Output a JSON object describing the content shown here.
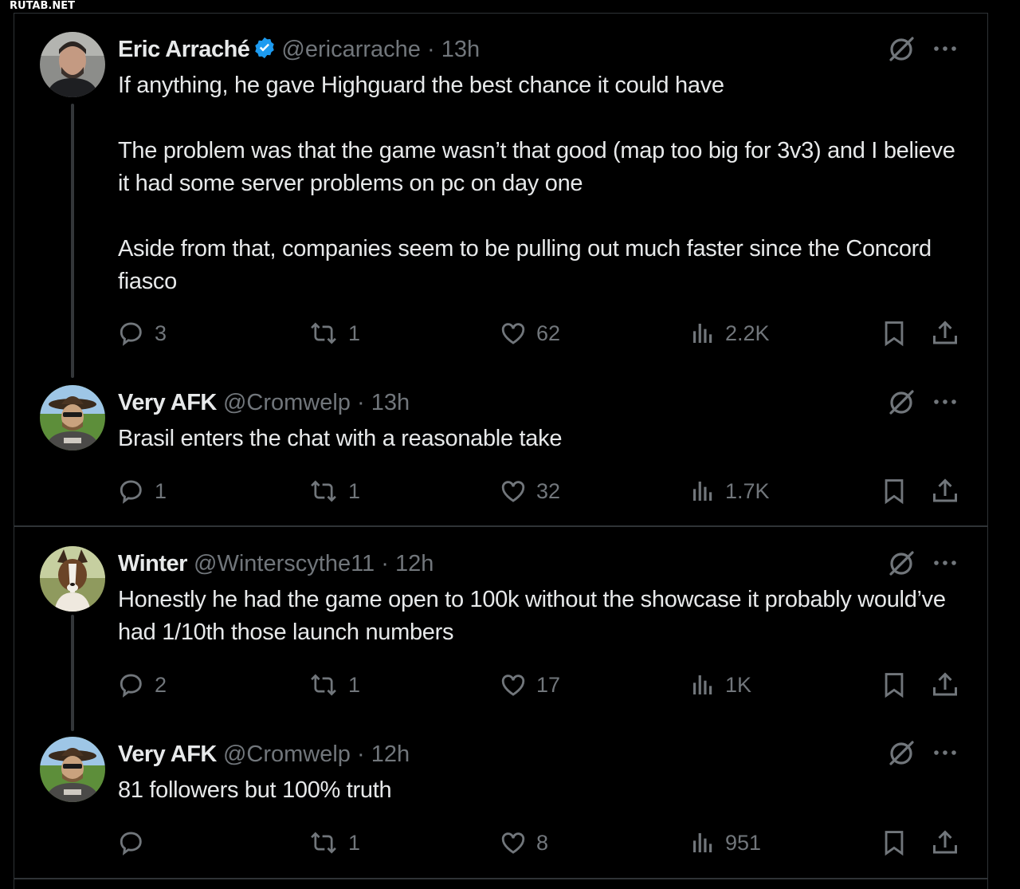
{
  "watermark": "RUTAB.NET",
  "tweets": [
    {
      "name": "Eric Arraché",
      "verified": true,
      "handle": "@ericarrache",
      "dot": "·",
      "time": "13h",
      "text": "If anything, he gave Highguard the best chance it could have\n\nThe problem was that the game wasn’t that good (map too big for 3v3) and I believe it had some server problems on pc on day one\n\nAside from that, companies seem to be pulling out much faster since the Concord fiasco",
      "replies": "3",
      "reposts": "1",
      "likes": "62",
      "views": "2.2K"
    },
    {
      "name": "Very AFK",
      "verified": false,
      "handle": "@Cromwelp",
      "dot": "·",
      "time": "13h",
      "text": "Brasil enters the chat with a reasonable take",
      "replies": "1",
      "reposts": "1",
      "likes": "32",
      "views": "1.7K"
    },
    {
      "name": "Winter",
      "verified": false,
      "handle": "@Winterscythe11",
      "dot": "·",
      "time": "12h",
      "text": "Honestly he had the game open to 100k without the showcase it probably would’ve had 1/10th those launch numbers",
      "replies": "2",
      "reposts": "1",
      "likes": "17",
      "views": "1K"
    },
    {
      "name": "Very AFK",
      "verified": false,
      "handle": "@Cromwelp",
      "dot": "·",
      "time": "12h",
      "text": "81 followers but 100% truth",
      "replies": "",
      "reposts": "1",
      "likes": "8",
      "views": "951"
    }
  ],
  "icons": {
    "reply": "reply-icon",
    "repost": "repost-icon",
    "like": "heart-icon",
    "views": "views-icon",
    "bookmark": "bookmark-icon",
    "share": "share-icon",
    "grok": "grok-icon",
    "more": "more-icon",
    "verified": "verified-badge-icon"
  },
  "colors": {
    "background": "#000000",
    "text": "#e7e9ea",
    "muted": "#71767b",
    "verified": "#1d9bf0",
    "divider": "#2f3336"
  }
}
